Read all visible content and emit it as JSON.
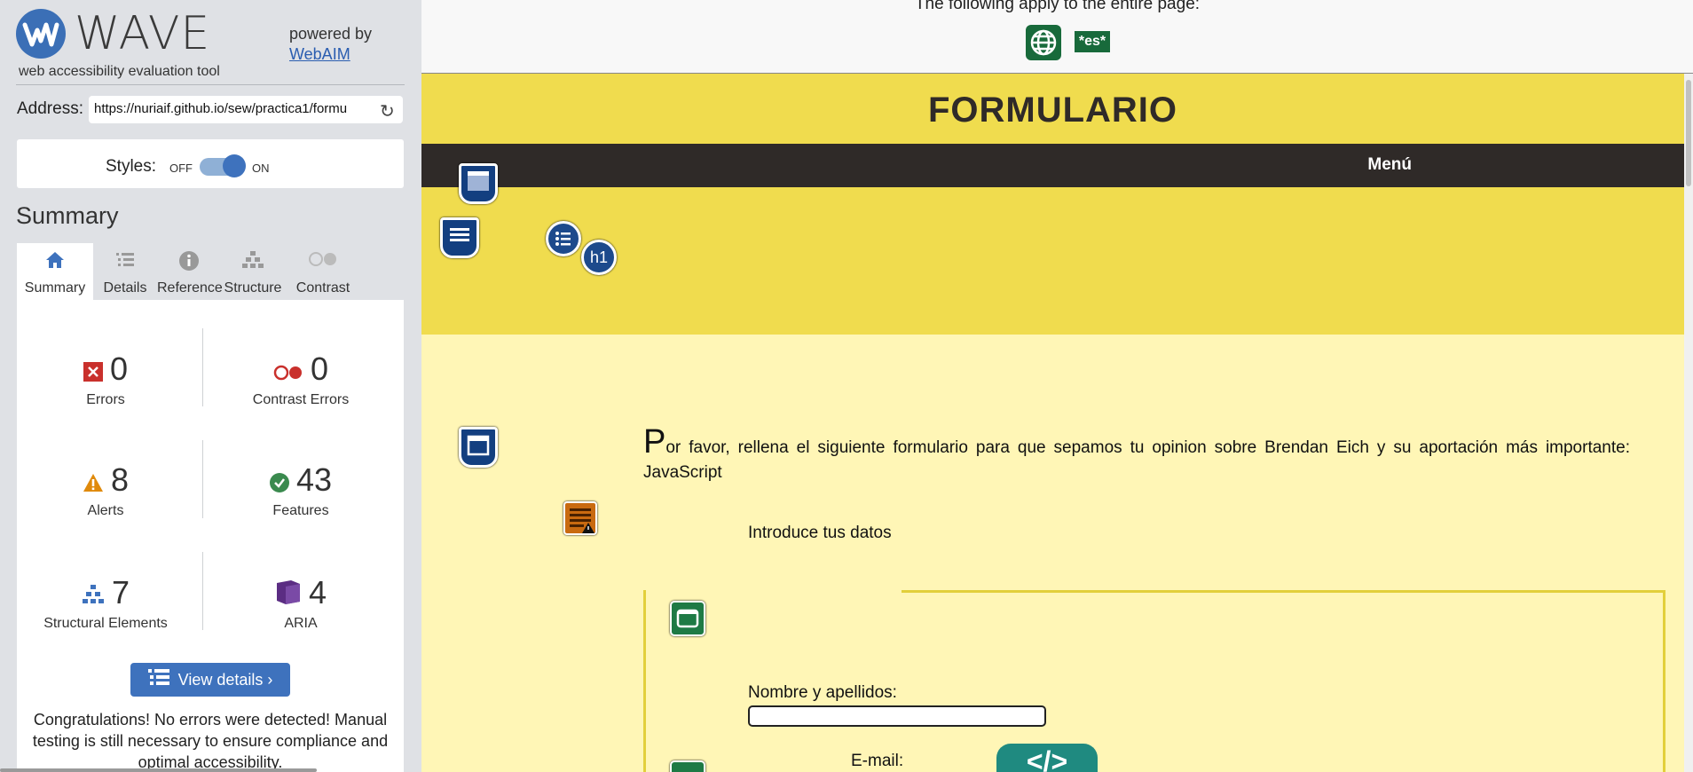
{
  "sidebar": {
    "logo_word": "WAVE",
    "logo_tagline": "web accessibility evaluation tool",
    "powered_by": "powered by",
    "webaim_link": "WebAIM",
    "address_label": "Address:",
    "address_value": "https://nuriaif.github.io/sew/practica1/formu",
    "styles_label": "Styles:",
    "styles_off": "OFF",
    "styles_on": "ON",
    "summary_title": "Summary",
    "tabs": [
      {
        "label": "Summary",
        "icon": "home-icon",
        "active": true
      },
      {
        "label": "Details",
        "icon": "list-icon"
      },
      {
        "label": "Reference",
        "icon": "info-icon"
      },
      {
        "label": "Structure",
        "icon": "structure-icon"
      },
      {
        "label": "Contrast",
        "icon": "contrast-icon"
      }
    ],
    "stats": {
      "errors": {
        "count": "0",
        "label": "Errors"
      },
      "contrast_errors": {
        "count": "0",
        "label": "Contrast Errors"
      },
      "alerts": {
        "count": "8",
        "label": "Alerts"
      },
      "features": {
        "count": "43",
        "label": "Features"
      },
      "structural": {
        "count": "7",
        "label": "Structural Elements"
      },
      "aria": {
        "count": "4",
        "label": "ARIA"
      }
    },
    "view_details": "View details ›",
    "congrats": "Congratulations! No errors were detected! Manual testing is still necessary to ensure compliance and optimal accessibility."
  },
  "page": {
    "applies_text": "The following apply to the entire page:",
    "lang_badge": "*es*",
    "title": "FORMULARIO",
    "nav_menu": "Menú",
    "intro_dropcap": "P",
    "intro_rest": "or favor, rellena el siguiente formulario para que sepamos tu opinion sobre Brendan Eich y su aportación más importante: JavaScript",
    "datos_label": "Introduce tus datos",
    "nombre_label": "Nombre y apellidos:",
    "email_label": "E-mail:",
    "h1_icon_text": "h1",
    "code_icon_text": "</>"
  },
  "colors": {
    "wave_blue": "#3e72bd",
    "header_yellow": "#f0dc4e",
    "content_yellow": "#fff6b6",
    "nav_dark": "#2f2a28",
    "feature_green": "#186a3b",
    "error_red": "#c9302c",
    "alert_orange": "#e08a0b",
    "aria_purple": "#5b2d83"
  }
}
